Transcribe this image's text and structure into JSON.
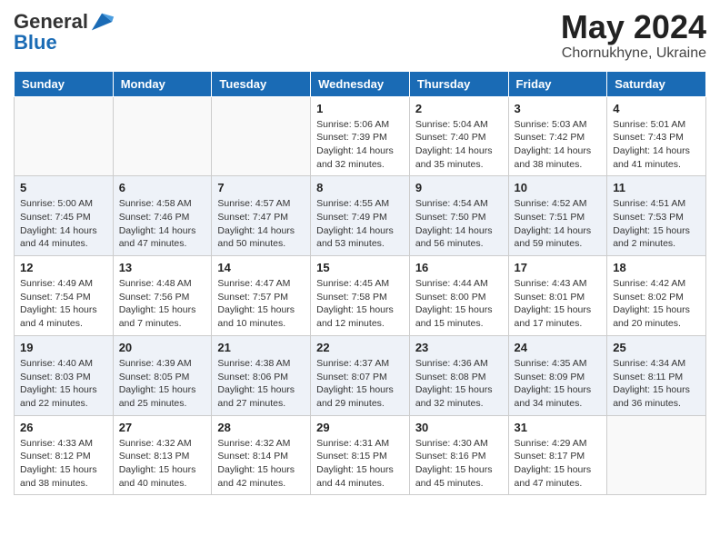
{
  "logo": {
    "line1": "General",
    "line2": "Blue"
  },
  "title": "May 2024",
  "subtitle": "Chornukhyne, Ukraine",
  "days_of_week": [
    "Sunday",
    "Monday",
    "Tuesday",
    "Wednesday",
    "Thursday",
    "Friday",
    "Saturday"
  ],
  "weeks": [
    {
      "parity": "odd",
      "days": [
        {
          "num": "",
          "info": ""
        },
        {
          "num": "",
          "info": ""
        },
        {
          "num": "",
          "info": ""
        },
        {
          "num": "1",
          "info": "Sunrise: 5:06 AM\nSunset: 7:39 PM\nDaylight: 14 hours\nand 32 minutes."
        },
        {
          "num": "2",
          "info": "Sunrise: 5:04 AM\nSunset: 7:40 PM\nDaylight: 14 hours\nand 35 minutes."
        },
        {
          "num": "3",
          "info": "Sunrise: 5:03 AM\nSunset: 7:42 PM\nDaylight: 14 hours\nand 38 minutes."
        },
        {
          "num": "4",
          "info": "Sunrise: 5:01 AM\nSunset: 7:43 PM\nDaylight: 14 hours\nand 41 minutes."
        }
      ]
    },
    {
      "parity": "even",
      "days": [
        {
          "num": "5",
          "info": "Sunrise: 5:00 AM\nSunset: 7:45 PM\nDaylight: 14 hours\nand 44 minutes."
        },
        {
          "num": "6",
          "info": "Sunrise: 4:58 AM\nSunset: 7:46 PM\nDaylight: 14 hours\nand 47 minutes."
        },
        {
          "num": "7",
          "info": "Sunrise: 4:57 AM\nSunset: 7:47 PM\nDaylight: 14 hours\nand 50 minutes."
        },
        {
          "num": "8",
          "info": "Sunrise: 4:55 AM\nSunset: 7:49 PM\nDaylight: 14 hours\nand 53 minutes."
        },
        {
          "num": "9",
          "info": "Sunrise: 4:54 AM\nSunset: 7:50 PM\nDaylight: 14 hours\nand 56 minutes."
        },
        {
          "num": "10",
          "info": "Sunrise: 4:52 AM\nSunset: 7:51 PM\nDaylight: 14 hours\nand 59 minutes."
        },
        {
          "num": "11",
          "info": "Sunrise: 4:51 AM\nSunset: 7:53 PM\nDaylight: 15 hours\nand 2 minutes."
        }
      ]
    },
    {
      "parity": "odd",
      "days": [
        {
          "num": "12",
          "info": "Sunrise: 4:49 AM\nSunset: 7:54 PM\nDaylight: 15 hours\nand 4 minutes."
        },
        {
          "num": "13",
          "info": "Sunrise: 4:48 AM\nSunset: 7:56 PM\nDaylight: 15 hours\nand 7 minutes."
        },
        {
          "num": "14",
          "info": "Sunrise: 4:47 AM\nSunset: 7:57 PM\nDaylight: 15 hours\nand 10 minutes."
        },
        {
          "num": "15",
          "info": "Sunrise: 4:45 AM\nSunset: 7:58 PM\nDaylight: 15 hours\nand 12 minutes."
        },
        {
          "num": "16",
          "info": "Sunrise: 4:44 AM\nSunset: 8:00 PM\nDaylight: 15 hours\nand 15 minutes."
        },
        {
          "num": "17",
          "info": "Sunrise: 4:43 AM\nSunset: 8:01 PM\nDaylight: 15 hours\nand 17 minutes."
        },
        {
          "num": "18",
          "info": "Sunrise: 4:42 AM\nSunset: 8:02 PM\nDaylight: 15 hours\nand 20 minutes."
        }
      ]
    },
    {
      "parity": "even",
      "days": [
        {
          "num": "19",
          "info": "Sunrise: 4:40 AM\nSunset: 8:03 PM\nDaylight: 15 hours\nand 22 minutes."
        },
        {
          "num": "20",
          "info": "Sunrise: 4:39 AM\nSunset: 8:05 PM\nDaylight: 15 hours\nand 25 minutes."
        },
        {
          "num": "21",
          "info": "Sunrise: 4:38 AM\nSunset: 8:06 PM\nDaylight: 15 hours\nand 27 minutes."
        },
        {
          "num": "22",
          "info": "Sunrise: 4:37 AM\nSunset: 8:07 PM\nDaylight: 15 hours\nand 29 minutes."
        },
        {
          "num": "23",
          "info": "Sunrise: 4:36 AM\nSunset: 8:08 PM\nDaylight: 15 hours\nand 32 minutes."
        },
        {
          "num": "24",
          "info": "Sunrise: 4:35 AM\nSunset: 8:09 PM\nDaylight: 15 hours\nand 34 minutes."
        },
        {
          "num": "25",
          "info": "Sunrise: 4:34 AM\nSunset: 8:11 PM\nDaylight: 15 hours\nand 36 minutes."
        }
      ]
    },
    {
      "parity": "odd",
      "days": [
        {
          "num": "26",
          "info": "Sunrise: 4:33 AM\nSunset: 8:12 PM\nDaylight: 15 hours\nand 38 minutes."
        },
        {
          "num": "27",
          "info": "Sunrise: 4:32 AM\nSunset: 8:13 PM\nDaylight: 15 hours\nand 40 minutes."
        },
        {
          "num": "28",
          "info": "Sunrise: 4:32 AM\nSunset: 8:14 PM\nDaylight: 15 hours\nand 42 minutes."
        },
        {
          "num": "29",
          "info": "Sunrise: 4:31 AM\nSunset: 8:15 PM\nDaylight: 15 hours\nand 44 minutes."
        },
        {
          "num": "30",
          "info": "Sunrise: 4:30 AM\nSunset: 8:16 PM\nDaylight: 15 hours\nand 45 minutes."
        },
        {
          "num": "31",
          "info": "Sunrise: 4:29 AM\nSunset: 8:17 PM\nDaylight: 15 hours\nand 47 minutes."
        },
        {
          "num": "",
          "info": ""
        }
      ]
    }
  ]
}
